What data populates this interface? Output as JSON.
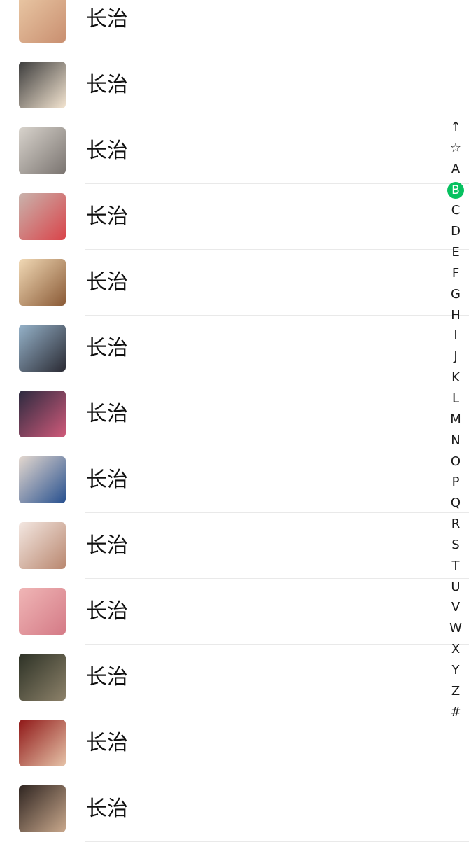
{
  "contacts": [
    {
      "name": "长治",
      "avatar": "blurred-photo-avatar",
      "colors": [
        "#e9c7a4",
        "#c98f70"
      ]
    },
    {
      "name": "长治",
      "avatar": "cartoon-boy-avatar",
      "colors": [
        "#3c3c3c",
        "#f4e5d1"
      ]
    },
    {
      "name": "长治",
      "avatar": "woman-photo-avatar",
      "colors": [
        "#d8d3cc",
        "#7a7470"
      ]
    },
    {
      "name": "长治",
      "avatar": "child-photo-avatar",
      "colors": [
        "#c9b3ac",
        "#d9444a"
      ]
    },
    {
      "name": "长治",
      "avatar": "anime-girl-avatar",
      "colors": [
        "#f1d9b5",
        "#8a5a36"
      ]
    },
    {
      "name": "长治",
      "avatar": "woman-seaside-avatar",
      "colors": [
        "#95b2c9",
        "#2a2a33"
      ]
    },
    {
      "name": "长治",
      "avatar": "night-street-avatar",
      "colors": [
        "#2c2a3f",
        "#d05a7a"
      ]
    },
    {
      "name": "长治",
      "avatar": "woman-poster-avatar",
      "colors": [
        "#e4d8cf",
        "#27508f"
      ]
    },
    {
      "name": "长治",
      "avatar": "woman-portrait-avatar",
      "colors": [
        "#f3e7e1",
        "#b9876f"
      ]
    },
    {
      "name": "长治",
      "avatar": "anime-pink-avatar",
      "colors": [
        "#f0b6b6",
        "#d47a86"
      ]
    },
    {
      "name": "长治",
      "avatar": "dark-photo-avatar",
      "colors": [
        "#2d3226",
        "#8c8169"
      ]
    },
    {
      "name": "长治",
      "avatar": "red-2024-avatar",
      "colors": [
        "#8f1717",
        "#e6c3a8"
      ]
    },
    {
      "name": "长治",
      "avatar": "moody-photo-avatar",
      "colors": [
        "#2f2521",
        "#c9a88c"
      ]
    }
  ],
  "index_bar": {
    "items": [
      "↑",
      "☆",
      "A",
      "B",
      "C",
      "D",
      "E",
      "F",
      "G",
      "H",
      "I",
      "J",
      "K",
      "L",
      "M",
      "N",
      "O",
      "P",
      "Q",
      "R",
      "S",
      "T",
      "U",
      "V",
      "W",
      "X",
      "Y",
      "Z",
      "#"
    ],
    "active": "B",
    "accent": "#07c160"
  }
}
